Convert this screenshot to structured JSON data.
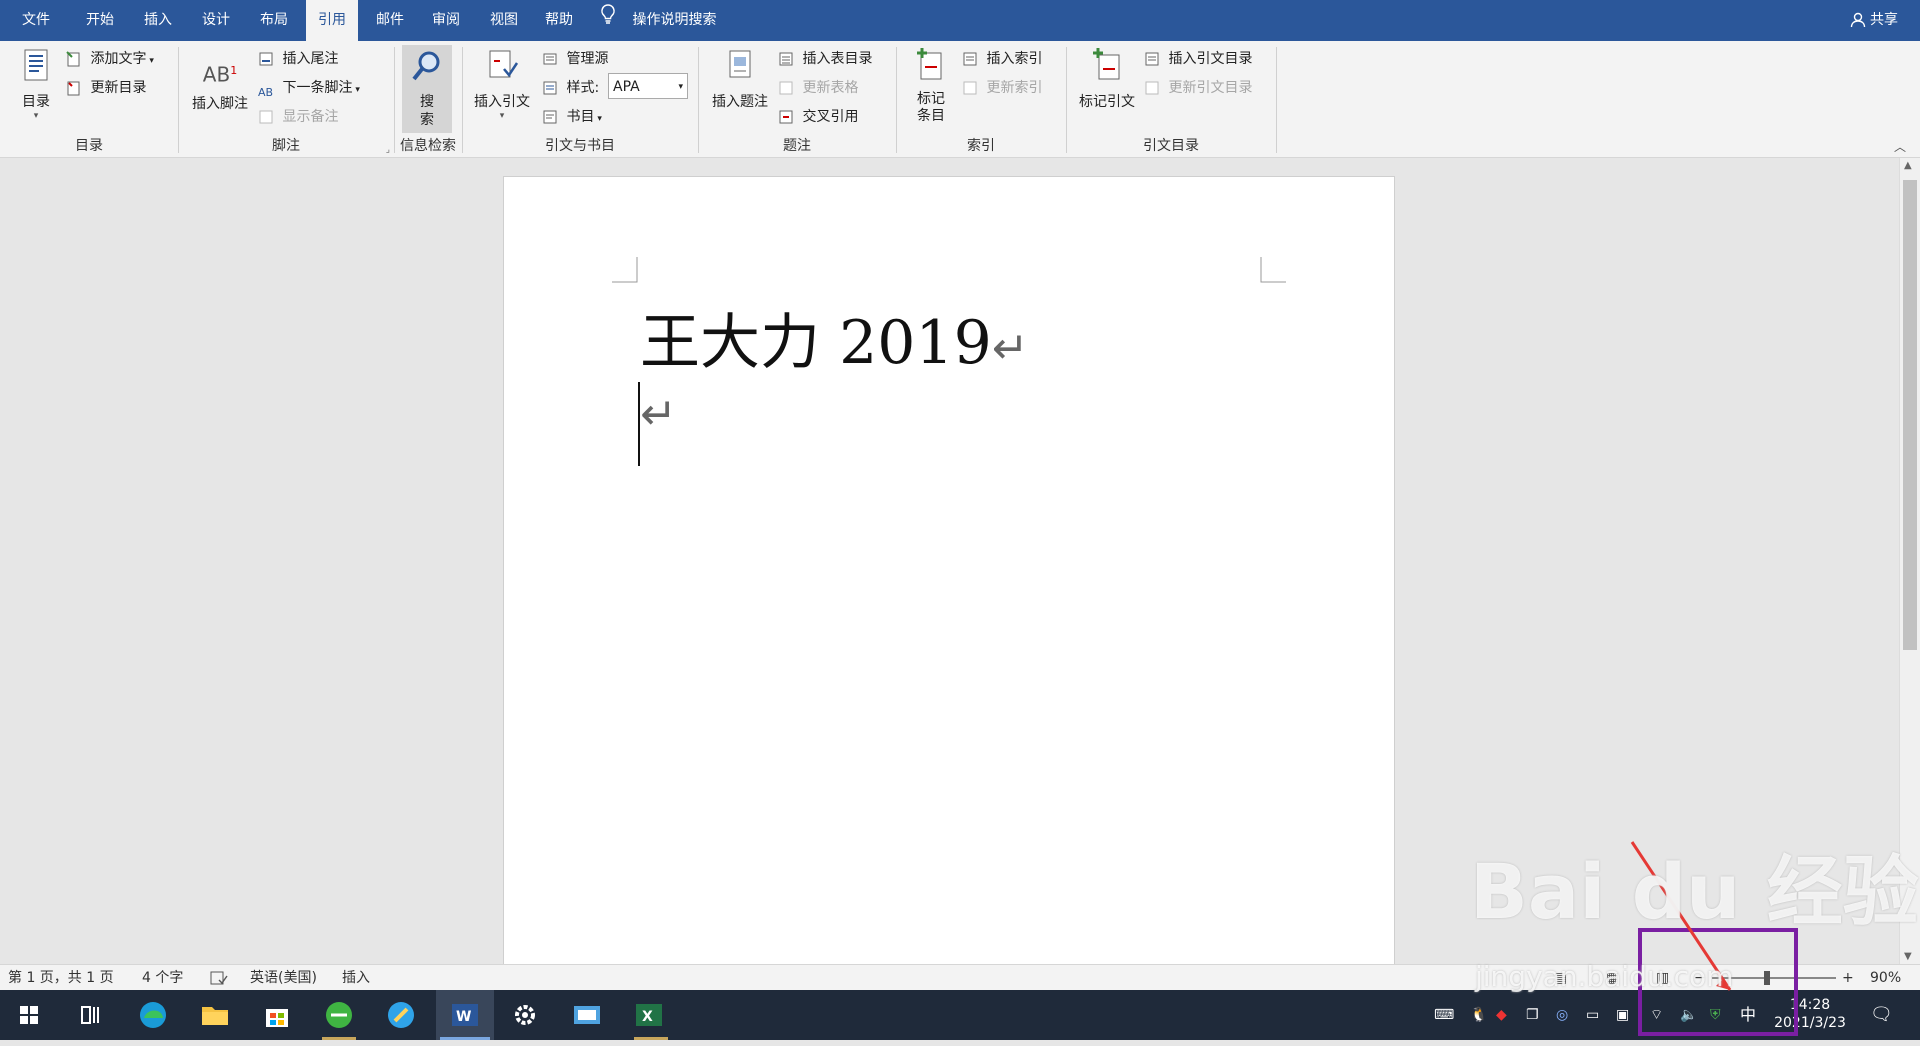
{
  "tabs": [
    "文件",
    "开始",
    "插入",
    "设计",
    "布局",
    "引用",
    "邮件",
    "审阅",
    "视图",
    "帮助"
  ],
  "active_tab": "引用",
  "tell_me": "操作说明搜索",
  "share": "共享",
  "ribbon": {
    "toc": {
      "label": "目录",
      "big": "目录",
      "add_text": "添加文字",
      "update": "更新目录"
    },
    "footnotes": {
      "label": "脚注",
      "insert_footnote": "插入脚注",
      "insert_endnote": "插入尾注",
      "next_footnote": "下一条脚注",
      "show_notes": "显示备注",
      "ab_glyph": "AB"
    },
    "research": {
      "label": "信息检索",
      "search": "搜索"
    },
    "citations": {
      "label": "引文与书目",
      "insert_citation": "插入引文",
      "manage_sources": "管理源",
      "style_label": "样式:",
      "style_value": "APA",
      "bibliography": "书目"
    },
    "captions": {
      "label": "题注",
      "insert_caption": "插入题注",
      "insert_tof": "插入表目录",
      "update_table": "更新表格",
      "cross_ref": "交叉引用"
    },
    "index": {
      "label": "索引",
      "mark_entry": "标记条目",
      "insert_index": "插入索引",
      "update_index": "更新索引"
    },
    "toa": {
      "label": "引文目录",
      "mark_citation": "标记引文",
      "insert_toa": "插入引文目录",
      "update_toa": "更新引文目录"
    }
  },
  "document": {
    "line1": "王大力 2019",
    "return_mark": "↵"
  },
  "status": {
    "page": "第 1 页，共 1 页",
    "words": "4 个字",
    "language": "英语(美国)",
    "mode": "插入",
    "zoom": "90%"
  },
  "taskbar": {
    "ime": "中",
    "time": "14:28",
    "date": "2021/3/23"
  },
  "watermark": {
    "text": "Bai du 经验",
    "sub": "jingyan.baidu.com"
  },
  "colors": {
    "word_blue": "#2b579a",
    "taskbar": "#1f2a3a",
    "highlight": "#7a1fa2"
  }
}
